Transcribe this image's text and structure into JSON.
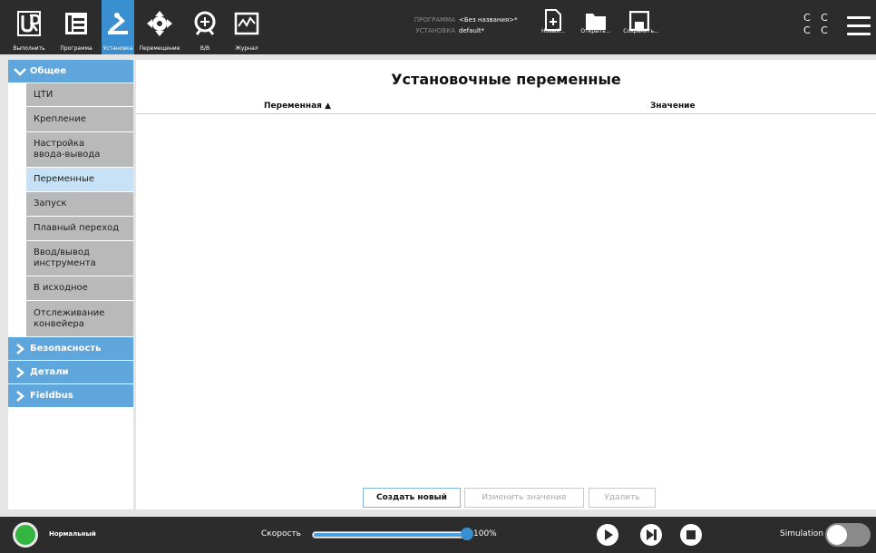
{
  "topnav": {
    "items": [
      {
        "label": "Выполнить"
      },
      {
        "label": "Программа"
      },
      {
        "label": "Установка"
      },
      {
        "label": "Перемещение"
      },
      {
        "label": "В/В"
      },
      {
        "label": "Журнал"
      }
    ],
    "program_key": "ПРОГРАММА",
    "program_value": "<Без названия>*",
    "install_key": "УСТАНОВКА",
    "install_value": "default*",
    "new_label": "Новый...",
    "open_label": "Открыть...",
    "save_label": "Сохранить...",
    "cc": [
      "C C",
      "C C"
    ]
  },
  "sidebar": {
    "general": "Общее",
    "items": [
      {
        "label": "ЦТИ"
      },
      {
        "label": "Крепление"
      },
      {
        "label": "Настройка ввода-вывода"
      },
      {
        "label": "Переменные"
      },
      {
        "label": "Запуск"
      },
      {
        "label": "Плавный переход"
      },
      {
        "label": "Ввод/вывод инструмента"
      },
      {
        "label": "В исходное"
      },
      {
        "label": "Отслеживание конвейера"
      }
    ],
    "sections": [
      {
        "label": "Безопасность"
      },
      {
        "label": "Детали"
      },
      {
        "label": "Fieldbus"
      }
    ]
  },
  "main": {
    "title": "Установочные переменные",
    "col_variable": "Переменная ▲",
    "col_value": "Значение",
    "btn_create": "Создать новый",
    "btn_edit": "Изменить значение",
    "btn_delete": "Удалить"
  },
  "bottom": {
    "status": "Нормальный",
    "speed_label": "Скорость",
    "speed_value": "100%",
    "speed_fraction": 1.0,
    "simulation_label": "Simulation"
  },
  "colors": {
    "accent": "#3a8fd0",
    "topbar": "#2c2c2c",
    "selected": "#c7e2f7",
    "status_ok": "#32b640"
  }
}
